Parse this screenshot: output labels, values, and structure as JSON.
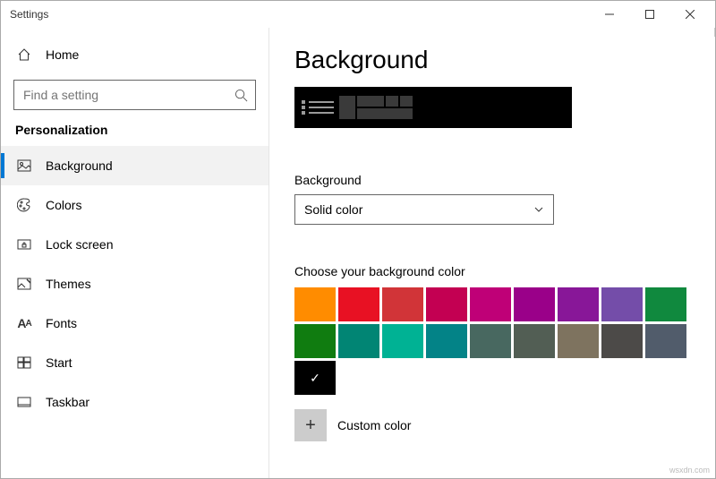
{
  "window": {
    "title": "Settings"
  },
  "sidebar": {
    "home_label": "Home",
    "search_placeholder": "Find a setting",
    "section_label": "Personalization",
    "items": [
      {
        "label": "Background",
        "icon": "picture-icon",
        "active": true
      },
      {
        "label": "Colors",
        "icon": "palette-icon"
      },
      {
        "label": "Lock screen",
        "icon": "lockscreen-icon"
      },
      {
        "label": "Themes",
        "icon": "themes-icon"
      },
      {
        "label": "Fonts",
        "icon": "fonts-icon"
      },
      {
        "label": "Start",
        "icon": "start-icon"
      },
      {
        "label": "Taskbar",
        "icon": "taskbar-icon"
      }
    ]
  },
  "main": {
    "page_title": "Background",
    "background_label": "Background",
    "background_value": "Solid color",
    "swatch_label": "Choose your background color",
    "swatches": [
      {
        "hex": "#ff8c00"
      },
      {
        "hex": "#e81123"
      },
      {
        "hex": "#d13438"
      },
      {
        "hex": "#c30052"
      },
      {
        "hex": "#bf0077"
      },
      {
        "hex": "#9a0089"
      },
      {
        "hex": "#881798"
      },
      {
        "hex": "#744da9"
      },
      {
        "hex": "#10893e"
      },
      {
        "hex": "#107c10"
      },
      {
        "hex": "#018574"
      },
      {
        "hex": "#00b294"
      },
      {
        "hex": "#038387"
      },
      {
        "hex": "#486860"
      },
      {
        "hex": "#525e54"
      },
      {
        "hex": "#7e735f"
      },
      {
        "hex": "#4c4a48"
      },
      {
        "hex": "#515c6b"
      },
      {
        "hex": "#000000",
        "selected": true
      }
    ],
    "custom_color_label": "Custom color"
  },
  "watermark": "wsxdn.com"
}
